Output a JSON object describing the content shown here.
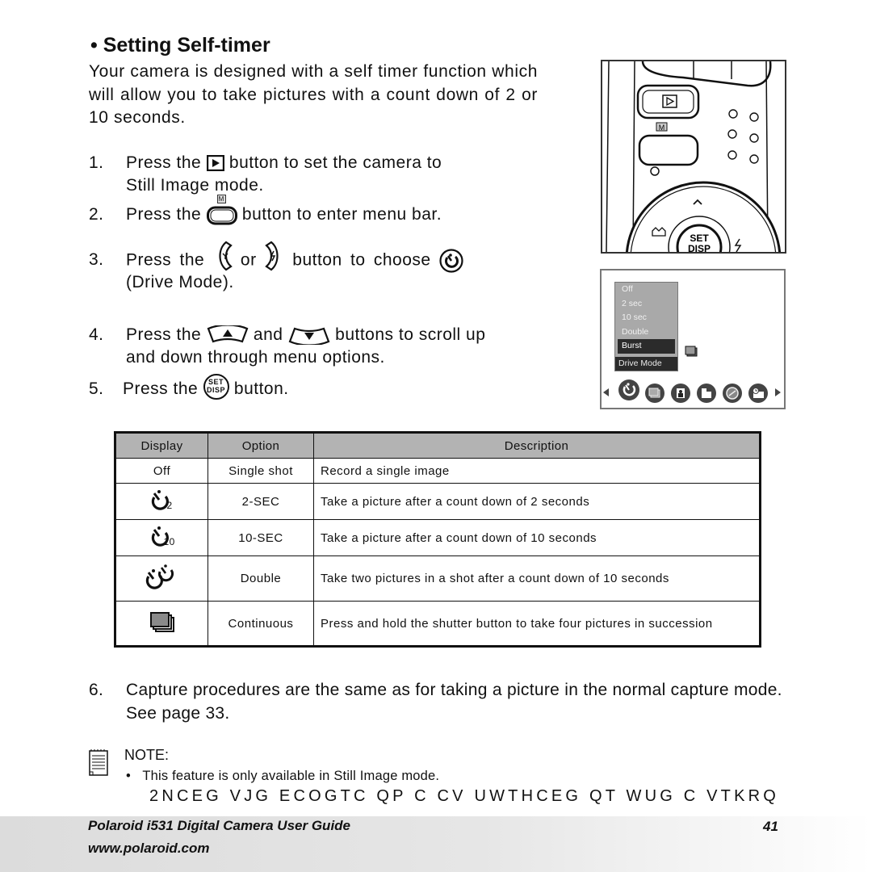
{
  "heading": "• Setting Self-timer",
  "intro": "Your camera is designed with a self timer function which will allow you to take pictures with a count down of 2 or 10 seconds.",
  "steps": [
    {
      "num": "1.",
      "pre": "Press the",
      "icon": "playback-button-icon",
      "post": "button to set the camera to",
      "line2": "Still Image mode."
    },
    {
      "num": "2.",
      "pre": "Press the",
      "icon": "menu-button-icon",
      "icon_label": "M",
      "post": "button to enter menu bar."
    },
    {
      "num": "3.",
      "pre": "Press the",
      "icon": "macro-left-button-icon",
      "mid": "or",
      "icon2": "flash-right-button-icon",
      "post": "button to choose",
      "icon3": "drive-mode-icon",
      "line2": "(Drive Mode)."
    },
    {
      "num": "4.",
      "pre": "Press the",
      "icon": "up-button-icon",
      "mid": "and",
      "icon2": "down-button-icon",
      "post": "buttons to scroll up",
      "line2": "and down through menu options."
    },
    {
      "num": "5.",
      "pre": "Press the",
      "icon": "set-disp-button-icon",
      "icon_label_top": "SET",
      "icon_label_bottom": "DISP",
      "post": "button."
    }
  ],
  "camera_illustration": {
    "labels": {
      "menu": "M",
      "set": "SET",
      "disp": "DISP"
    }
  },
  "lcd_menu": {
    "options": [
      "Off",
      "2 sec",
      "10 sec",
      "Double",
      "Burst"
    ],
    "selected": "Burst",
    "title": "Drive Mode",
    "icons": [
      "drive-mode-icon",
      "continuous-icon",
      "portrait-icon",
      "image-size-icon",
      "quality-icon",
      "date-stamp-icon"
    ]
  },
  "table": {
    "headers": [
      "Display",
      "Option",
      "Description"
    ],
    "rows": [
      {
        "display": "Off",
        "display_icon": "",
        "option": "Single shot",
        "description": "Record a single image"
      },
      {
        "display": "",
        "display_icon": "self-timer-2sec-icon",
        "display_sub": "2",
        "option": "2-SEC",
        "description": "Take a picture after a count down of 2 seconds"
      },
      {
        "display": "",
        "display_icon": "self-timer-10sec-icon",
        "display_sub": "10",
        "option": "10-SEC",
        "description": "Take a picture after a count down of 10 seconds"
      },
      {
        "display": "",
        "display_icon": "self-timer-double-icon",
        "option": "Double",
        "description": "Take two pictures in a shot after a count down of 10 seconds"
      },
      {
        "display": "",
        "display_icon": "continuous-shot-icon",
        "option": "Continuous",
        "description": "Press and hold the shutter button to take four pictures in succession"
      }
    ]
  },
  "step6": {
    "num": "6.",
    "text": "Capture procedures are the same as for taking a picture in the normal capture mode. See page 33."
  },
  "note": {
    "title": "NOTE:",
    "bullet": "•",
    "text": "This feature is only available in Still Image mode.",
    "garbled": "2NCEG VJG ECOGTC QP C  CV UWTHCEG QT WUG C VTKRQ"
  },
  "footer": {
    "guide": "Polaroid i531 Digital Camera User Guide",
    "url": "www.polaroid.com",
    "page": "41"
  }
}
